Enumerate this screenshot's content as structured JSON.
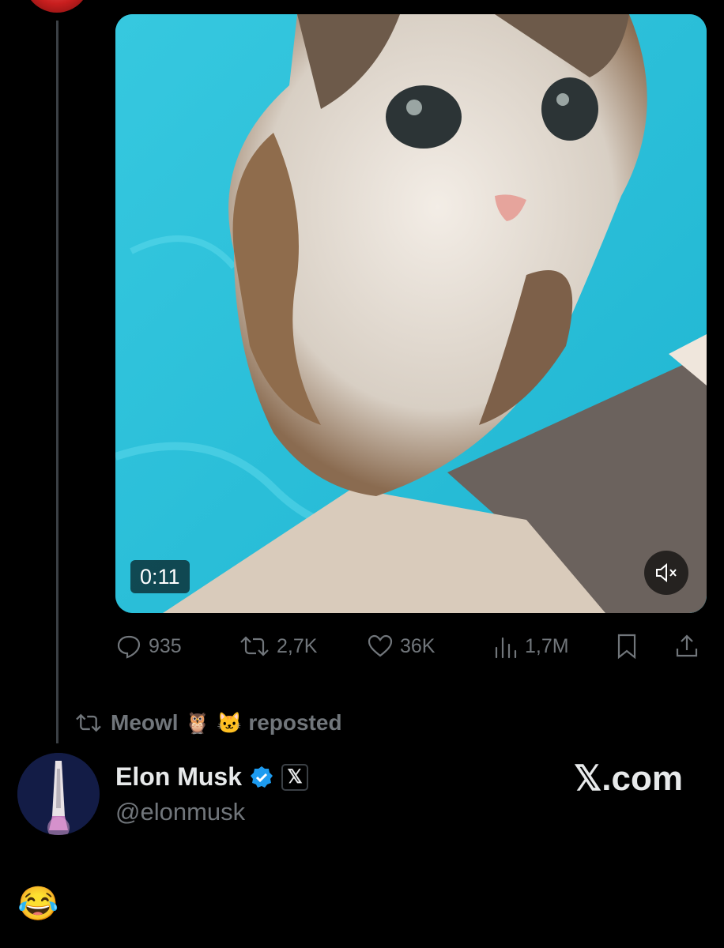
{
  "video": {
    "duration": "0:11",
    "muted": true
  },
  "actions": {
    "replies": "935",
    "reposts": "2,7K",
    "likes": "36K",
    "views": "1,7M"
  },
  "repost_banner": {
    "user": "Meowl",
    "emoji1": "🦉",
    "emoji2": "🐱",
    "label": "reposted"
  },
  "tweet": {
    "name": "Elon Musk",
    "handle": "@elonmusk",
    "x_badge": "𝕏",
    "site": "𝕏.com",
    "text": "😂"
  },
  "colors": {
    "background": "#000000",
    "muted_text": "#71767b",
    "primary_text": "#e7e9ea",
    "verified_blue": "#1d9bf0"
  }
}
